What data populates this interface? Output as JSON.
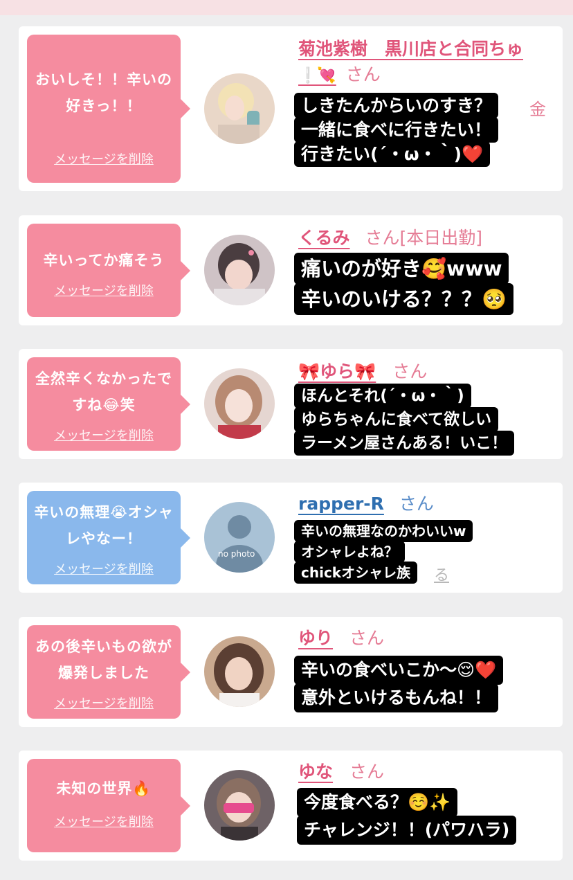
{
  "posts": [
    {
      "bubble": "おいしそ！！辛いの好きっ！！",
      "delete_label": "メッセージを削除",
      "name_line1": "菊池紫樹　黒川店と合同ちゅ",
      "name_line2": "❕💘",
      "san": "さん",
      "side_char": "金",
      "reply": [
        "しきたんからいのすき？",
        "一緒に食べに行きたい！",
        "行きたい(´・ω・｀)❤️"
      ]
    },
    {
      "bubble": "辛いってか痛そう",
      "delete_label": "メッセージを削除",
      "name": "くるみ",
      "san": "さん[本日出勤]",
      "reply": [
        "痛いのが好き🥰www",
        "辛いのいける？？？🥺"
      ]
    },
    {
      "bubble": "全然辛くなかったですね😂笑",
      "delete_label": "メッセージを削除",
      "name": "🎀ゆら🎀",
      "san": "さん",
      "reply": [
        "ほんとそれ(´・ω・｀)",
        "ゆらちゃんに食べて欲しい",
        "ラーメン屋さんある！いこ！"
      ]
    },
    {
      "bubble": "辛いの無理😭オシャレやなー！",
      "delete_label": "メッセージを削除",
      "name": "rapper-R",
      "san": "さん",
      "avatar_text": "no photo",
      "ghost_text": "る",
      "reply": [
        "辛いの無理なのかわいいw",
        "オシャレよね？",
        "chickオシャレ族"
      ]
    },
    {
      "bubble": "あの後辛いもの欲が爆発しました",
      "delete_label": "メッセージを削除",
      "name": "ゆり",
      "san": "さん",
      "reply": [
        "辛いの食べいこか〜😌❤️",
        "意外といけるもんね！！"
      ]
    },
    {
      "bubble": "未知の世界🔥",
      "delete_label": "メッセージを削除",
      "name": "ゆな",
      "san": "さん",
      "reply": [
        "今度食べる？☺️✨",
        "チャレンジ！！(パワハラ)"
      ]
    }
  ],
  "colors": {
    "pink_bubble": "#f58c9f",
    "blue_bubble": "#8ab8ec",
    "name_pink": "#e0557a",
    "name_blue": "#2f6fb0",
    "reply_bg": "#000000",
    "page_bg": "#eeeeef"
  }
}
